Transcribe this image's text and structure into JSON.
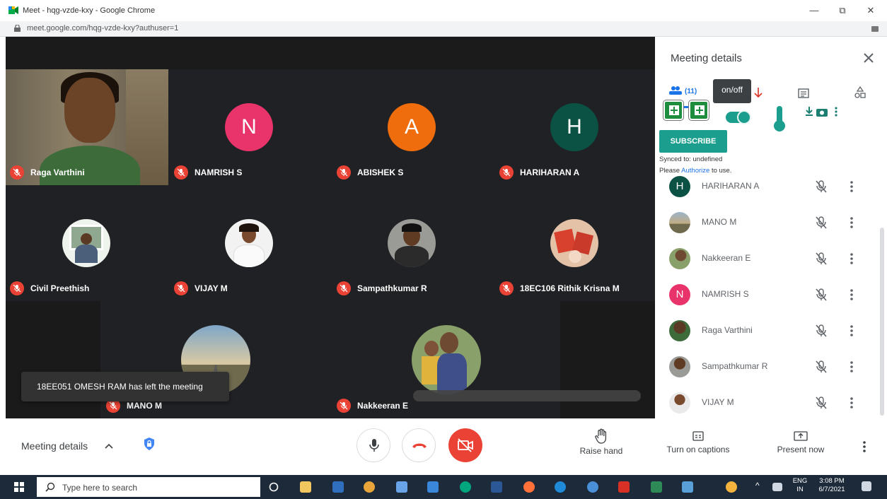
{
  "window": {
    "title": "Meet - hqg-vzde-kxy - Google Chrome",
    "url": "meet.google.com/hqg-vzde-kxy?authuser=1",
    "minimize": "—",
    "restore": "⧉",
    "close": "✕"
  },
  "tiles": [
    {
      "name": "Raga Varthini"
    },
    {
      "name": "NAMRISH S",
      "initial": "N",
      "color": "#e8336b"
    },
    {
      "name": "ABISHEK S",
      "initial": "A",
      "color": "#f06d0d"
    },
    {
      "name": "HARIHARAN A",
      "initial": "H",
      "color": "#0b5245"
    },
    {
      "name": "Civil Preethish"
    },
    {
      "name": "VIJAY M"
    },
    {
      "name": "Sampathkumar R"
    },
    {
      "name": "18EC106 Rithik Krisna M"
    },
    {
      "name": "MANO M"
    },
    {
      "name": "Nakkeeran E"
    }
  ],
  "toast": "18EE051 OMESH RAM has left the meeting",
  "panel": {
    "title": "Meeting details",
    "people_count": "(11)",
    "tooltip": "on/off",
    "subscribe": "SUBSCRIBE",
    "synced": "Synced to: undefined",
    "authorize_pre": "Please ",
    "authorize_link": "Authorize",
    "authorize_post": " to use.",
    "participants": [
      {
        "name": "HARIHARAN A",
        "initial": "H",
        "color": "#0b5245"
      },
      {
        "name": "MANO M"
      },
      {
        "name": "Nakkeeran E"
      },
      {
        "name": "NAMRISH S",
        "initial": "N",
        "color": "#e8336b"
      },
      {
        "name": "Raga Varthini"
      },
      {
        "name": "Sampathkumar R"
      },
      {
        "name": "VIJAY M"
      }
    ]
  },
  "bottom": {
    "meeting_details": "Meeting details",
    "raise_hand": "Raise hand",
    "captions": "Turn on captions",
    "present": "Present now"
  },
  "taskbar": {
    "search_placeholder": "Type here to search",
    "lang_top": "ENG",
    "lang_bottom": "IN",
    "time": "3:08 PM",
    "date": "6/7/2021"
  }
}
